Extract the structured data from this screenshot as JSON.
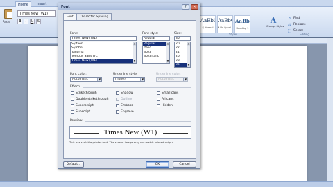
{
  "word": {
    "tabs": [
      {
        "label": "Home"
      },
      {
        "label": "Insert"
      }
    ],
    "clipboard": {
      "paste_label": "Paste"
    },
    "font_name": "Times New (W1)",
    "styles": [
      {
        "sample": "AaBbCcI",
        "name": "¶ Normal"
      },
      {
        "sample": "AaBbCcI",
        "name": "¶ No Spaci..."
      },
      {
        "sample": "AaBbCc",
        "name": "Heading 1"
      }
    ],
    "styles_group_label": "Styles",
    "change_styles_label": "Change Styles",
    "editing": [
      {
        "icon": "⌕",
        "label": "Find"
      },
      {
        "icon": "ab",
        "label": "Replace"
      },
      {
        "icon": "⬚",
        "label": "Select"
      }
    ],
    "editing_group_label": "Editing"
  },
  "dialog": {
    "title": "Font",
    "close_glyph": "✕",
    "help_glyph": "?",
    "tabs": [
      {
        "label": "Font"
      },
      {
        "label": "Character Spacing"
      }
    ],
    "font_label": "Font:",
    "font_value": "Times New (W1)",
    "font_list": [
      "Sylfaen",
      "Symbol",
      "Tahoma",
      "Tempus Sans ITC",
      "Times New (W1)"
    ],
    "font_list_selected": 4,
    "style_label": "Font style:",
    "style_value": "Regular",
    "style_list": [
      "Regular",
      "Italic",
      "Bold",
      "Bold Italic"
    ],
    "style_list_selected": 0,
    "size_label": "Size:",
    "size_value": "36",
    "size_list": [
      "20",
      "22",
      "24",
      "26",
      "28",
      "36"
    ],
    "size_list_selected": 5,
    "font_color_label": "Font color:",
    "font_color_value": "Automatic",
    "underline_style_label": "Underline style:",
    "underline_style_value": "(none)",
    "underline_color_label": "Underline color:",
    "underline_color_value": "Automatic",
    "effects_label": "Effects",
    "effects": [
      {
        "label": "Strikethrough",
        "disabled": false
      },
      {
        "label": "Double strikethrough",
        "disabled": false
      },
      {
        "label": "Superscript",
        "disabled": false
      },
      {
        "label": "Subscript",
        "disabled": false
      },
      {
        "label": "Shadow",
        "disabled": false
      },
      {
        "label": "Outline",
        "disabled": true
      },
      {
        "label": "Emboss",
        "disabled": false
      },
      {
        "label": "Engrave",
        "disabled": false
      },
      {
        "label": "Small caps",
        "disabled": false
      },
      {
        "label": "All caps",
        "disabled": false
      },
      {
        "label": "Hidden",
        "disabled": false
      }
    ],
    "preview_label": "Preview",
    "preview_text": "Times New (W1)",
    "preview_note": "This is a scalable printer font. The screen image may not match printed output.",
    "default_button": "Default...",
    "ok_button": "OK",
    "cancel_button": "Cancel"
  }
}
